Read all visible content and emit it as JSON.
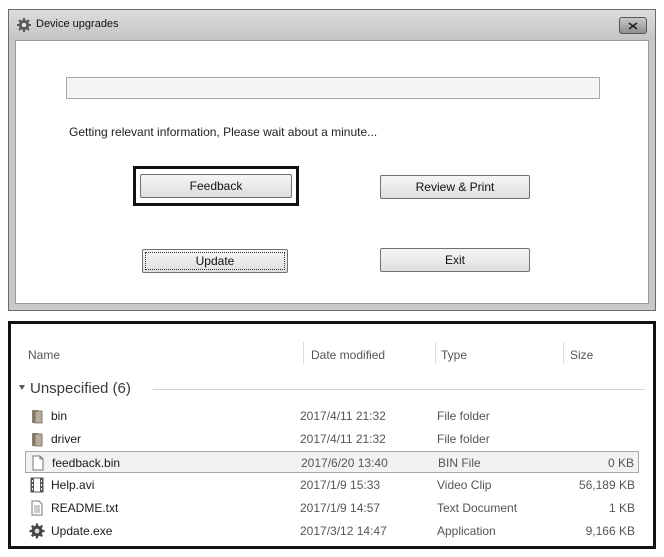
{
  "dialog": {
    "title": "Device upgrades",
    "status_text": "Getting relevant information, Please wait about a minute...",
    "progress": 0,
    "buttons": {
      "feedback": "Feedback",
      "review_print": "Review & Print",
      "update": "Update",
      "exit": "Exit"
    }
  },
  "explorer": {
    "columns": {
      "name": "Name",
      "date": "Date modified",
      "type": "Type",
      "size": "Size"
    },
    "group_label": "Unspecified (6)",
    "files": [
      {
        "name": "bin",
        "date": "2017/4/11 21:32",
        "type": "File folder",
        "size": "",
        "icon": "folder-icon"
      },
      {
        "name": "driver",
        "date": "2017/4/11 21:32",
        "type": "File folder",
        "size": "",
        "icon": "folder-icon"
      },
      {
        "name": "feedback.bin",
        "date": "2017/6/20 13:40",
        "type": "BIN File",
        "size": "0 KB",
        "icon": "file-icon",
        "selected": true
      },
      {
        "name": "Help.avi",
        "date": "2017/1/9 15:33",
        "type": "Video Clip",
        "size": "56,189 KB",
        "icon": "video-icon"
      },
      {
        "name": "README.txt",
        "date": "2017/1/9 14:57",
        "type": "Text Document",
        "size": "1 KB",
        "icon": "text-file-icon"
      },
      {
        "name": "Update.exe",
        "date": "2017/3/12 14:47",
        "type": "Application",
        "size": "9,166 KB",
        "icon": "gear-icon"
      }
    ]
  }
}
